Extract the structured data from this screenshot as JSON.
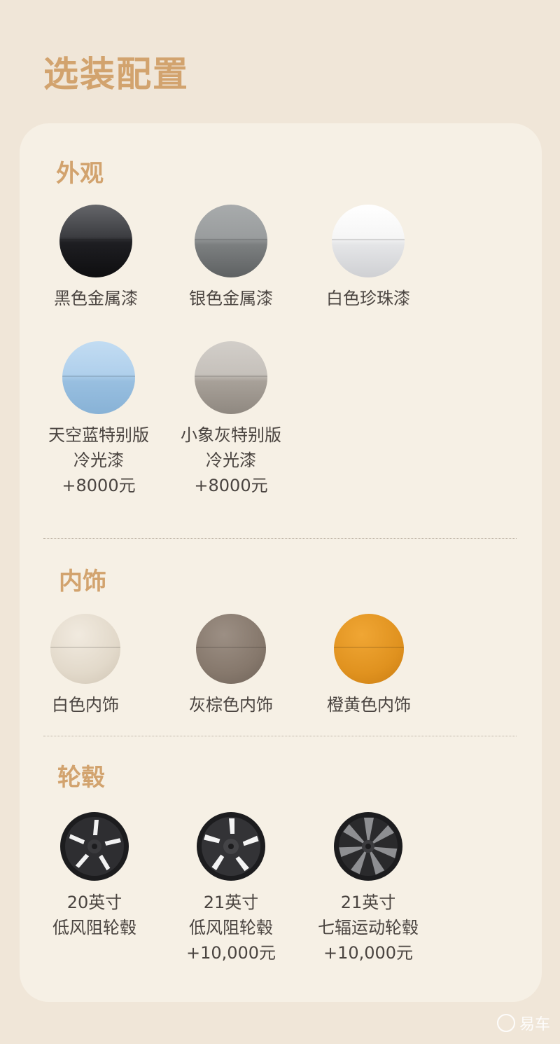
{
  "page_title": "选装配置",
  "sections": {
    "exterior": {
      "title": "外观",
      "items": [
        {
          "lines": [
            "黑色金属漆"
          ],
          "color": "#2a2a2e"
        },
        {
          "lines": [
            "银色金属漆"
          ],
          "color": "#8c8e8f"
        },
        {
          "lines": [
            "白色珍珠漆"
          ],
          "color": "#eeeeee"
        },
        {
          "lines": [
            "天空蓝特别版",
            "冷光漆",
            "+8000元"
          ],
          "color": "#a9cbe6"
        },
        {
          "lines": [
            "小象灰特别版",
            "冷光漆",
            "+8000元"
          ],
          "color": "#b4aea6"
        }
      ]
    },
    "interior": {
      "title": "内饰",
      "items": [
        {
          "lines": [
            "白色内饰"
          ],
          "color": "#e5dccd"
        },
        {
          "lines": [
            "灰棕色内饰"
          ],
          "color": "#86786c"
        },
        {
          "lines": [
            "橙黄色内饰"
          ],
          "color": "#e0921f"
        }
      ]
    },
    "wheels": {
      "title": "轮毂",
      "items": [
        {
          "lines": [
            "20英寸",
            "低风阻轮毂"
          ],
          "icon": "wheel-icon"
        },
        {
          "lines": [
            "21英寸",
            "低风阻轮毂",
            "+10,000元"
          ],
          "icon": "wheel-icon"
        },
        {
          "lines": [
            "21英寸",
            "七辐运动轮毂",
            "+10,000元"
          ],
          "icon": "wheel-icon"
        }
      ]
    }
  },
  "watermark": "易车"
}
